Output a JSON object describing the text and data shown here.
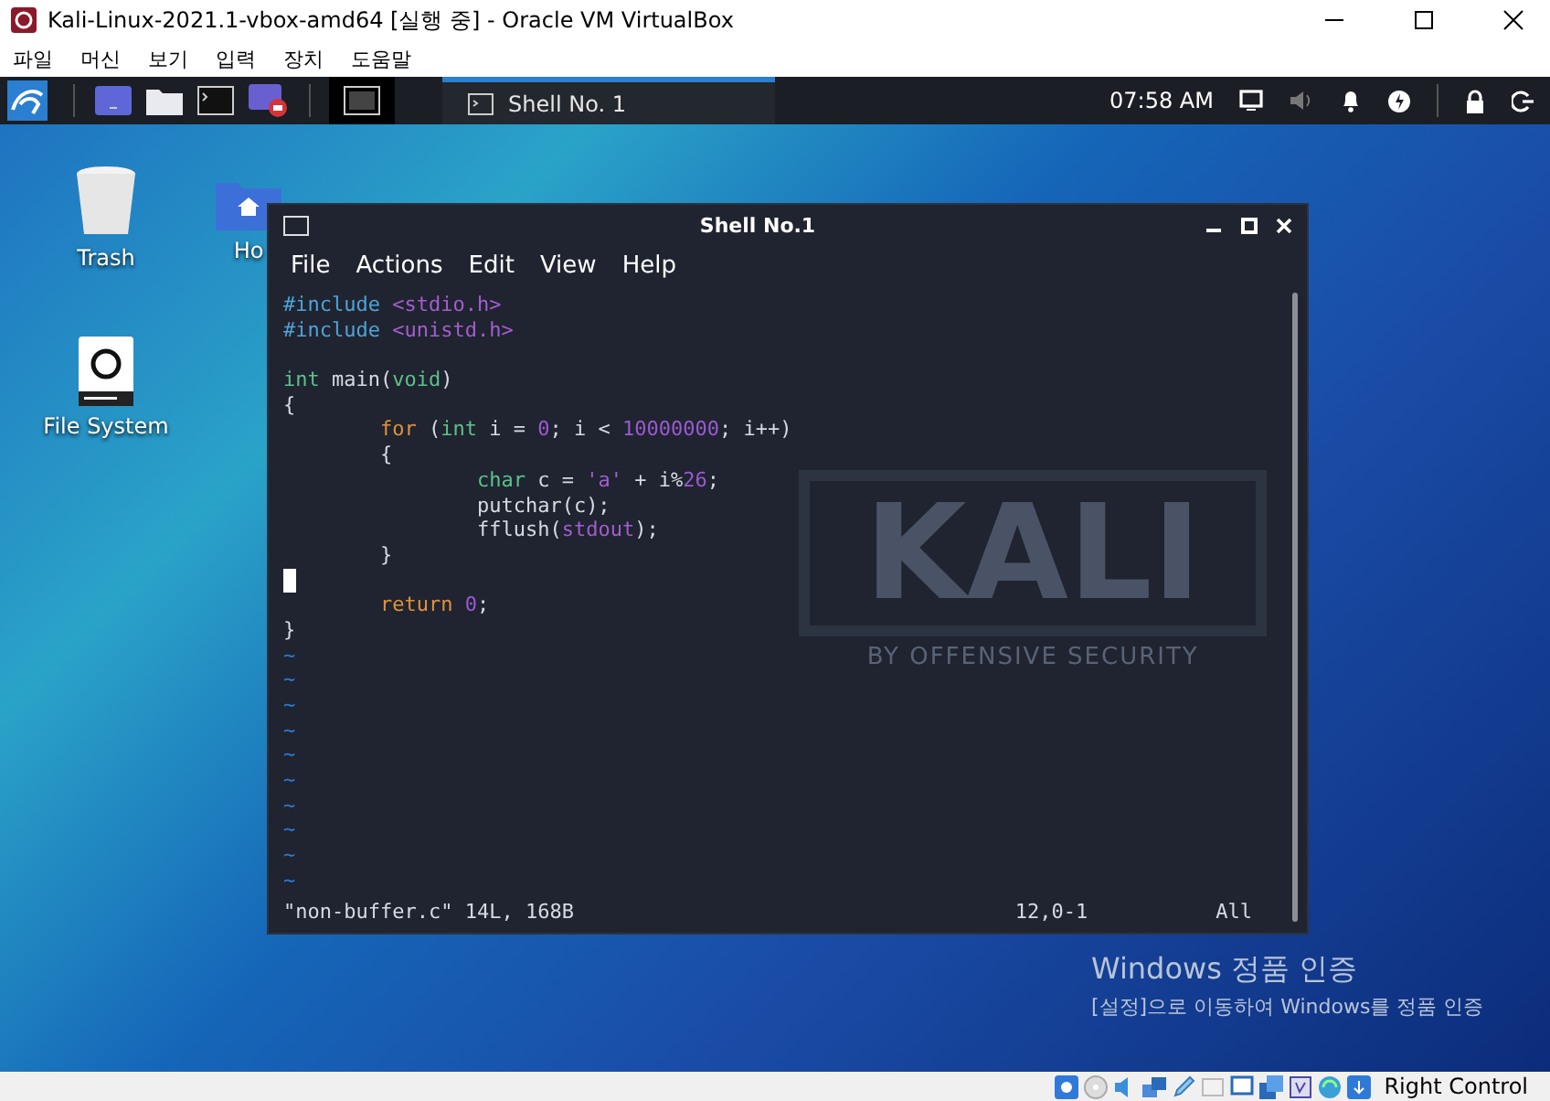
{
  "window": {
    "title": "Kali-Linux-2021.1-vbox-amd64 [실행 중] - Oracle VM VirtualBox"
  },
  "menu": [
    "파일",
    "머신",
    "보기",
    "입력",
    "장치",
    "도움말"
  ],
  "taskbar": {
    "tasks": [
      {
        "label": "Shell No. 1",
        "selected": true
      }
    ],
    "clock": "07:58 AM"
  },
  "desktop_icons": [
    {
      "kind": "trash",
      "label": "Trash"
    },
    {
      "kind": "home",
      "label": "Ho"
    },
    {
      "kind": "drive",
      "label": "File System"
    }
  ],
  "wallpaper": {
    "logo": "KALI",
    "tagline": "BY OFFENSIVE SECURITY"
  },
  "terminal": {
    "title": "Shell No.1",
    "menu": [
      "File",
      "Actions",
      "Edit",
      "View",
      "Help"
    ],
    "lines": [
      {
        "cursor": false,
        "tokens": [
          {
            "kind": "pre",
            "text": "#include "
          },
          {
            "kind": "str",
            "text": "<stdio.h>"
          }
        ]
      },
      {
        "cursor": false,
        "tokens": [
          {
            "kind": "pre",
            "text": "#include "
          },
          {
            "kind": "str",
            "text": "<unistd.h>"
          }
        ]
      },
      {
        "cursor": false
      },
      {
        "cursor": false,
        "tokens": [
          {
            "kind": "type",
            "text": "int"
          },
          {
            "kind": "plain",
            "text": " main("
          },
          {
            "kind": "type",
            "text": "void"
          },
          {
            "kind": "plain",
            "text": ")"
          }
        ]
      },
      {
        "cursor": false,
        "tokens": [
          {
            "kind": "plain",
            "text": "{"
          }
        ]
      },
      {
        "cursor": false,
        "tokens": [
          {
            "kind": "kw",
            "text": "        for"
          },
          {
            "kind": "plain",
            "text": " ("
          },
          {
            "kind": "type",
            "text": "int"
          },
          {
            "kind": "plain",
            "text": " i = "
          },
          {
            "kind": "num",
            "text": "0"
          },
          {
            "kind": "plain",
            "text": "; i < "
          },
          {
            "kind": "num",
            "text": "10000000"
          },
          {
            "kind": "plain",
            "text": "; i++)"
          }
        ]
      },
      {
        "cursor": false,
        "tokens": [
          {
            "kind": "plain",
            "text": "        {"
          }
        ]
      },
      {
        "cursor": false,
        "tokens": [
          {
            "kind": "type",
            "text": "                char"
          },
          {
            "kind": "plain",
            "text": " c = "
          },
          {
            "kind": "str",
            "text": "'a'"
          },
          {
            "kind": "plain",
            "text": " + i%"
          },
          {
            "kind": "num",
            "text": "26"
          },
          {
            "kind": "plain",
            "text": ";"
          }
        ]
      },
      {
        "cursor": false,
        "tokens": [
          {
            "kind": "plain",
            "text": "                putchar(c);"
          }
        ]
      },
      {
        "cursor": false,
        "tokens": [
          {
            "kind": "plain",
            "text": "                fflush("
          },
          {
            "kind": "str",
            "text": "stdout"
          },
          {
            "kind": "plain",
            "text": ");"
          }
        ]
      },
      {
        "cursor": false,
        "tokens": [
          {
            "kind": "plain",
            "text": "        }"
          }
        ]
      },
      {
        "cursor": true
      },
      {
        "cursor": false,
        "tokens": [
          {
            "kind": "kw",
            "text": "        return"
          },
          {
            "kind": "num",
            "text": " 0"
          },
          {
            "kind": "plain",
            "text": ";"
          }
        ]
      },
      {
        "cursor": false,
        "tokens": [
          {
            "kind": "plain",
            "text": "}"
          }
        ]
      }
    ],
    "tildes": [
      "~",
      "~",
      "~",
      "~",
      "~",
      "~",
      "~",
      "~",
      "~",
      "~"
    ],
    "status": {
      "file_info": "\"non-buffer.c\" 14L, 168B",
      "position": "12,0-1",
      "scroll": "All"
    }
  },
  "activation": {
    "title": "Windows 정품 인증",
    "message": "[설정]으로 이동하여 Windows를 정품 인증"
  },
  "host_status": {
    "host_key": "Right Control"
  }
}
